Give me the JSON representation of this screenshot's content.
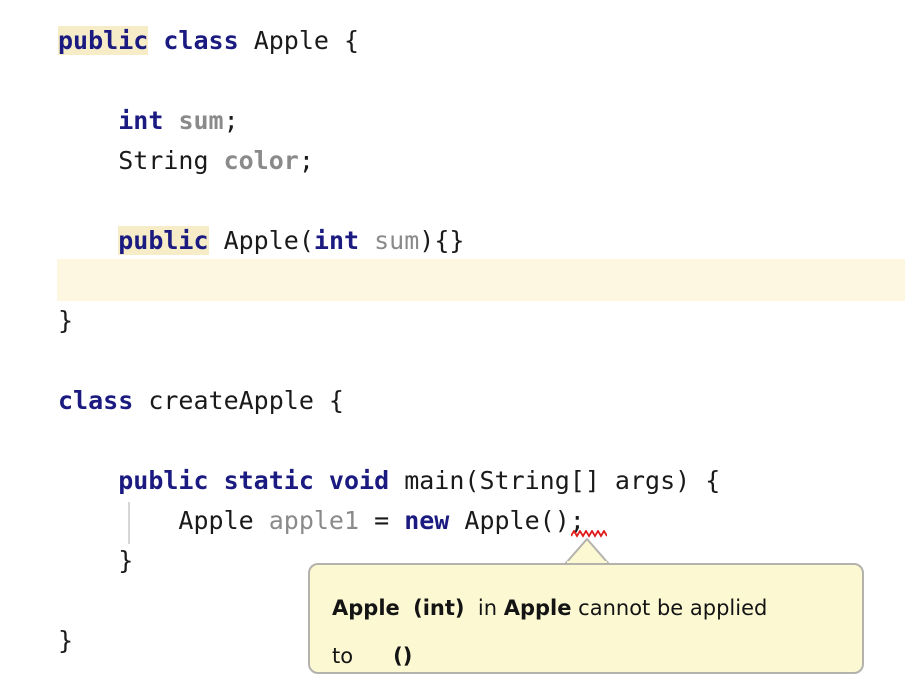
{
  "editor": {
    "background_color": "#ffffff",
    "keyword_color": "#1a1a80",
    "identifier_color": "#8a8a8a",
    "text_color": "#1a1a1a",
    "highlight_color": "#f6edc8",
    "caret_line_color": "#fdf6e0",
    "error_squiggle_color": "#e01b1b",
    "indent_guide_color": "#d7d7d7",
    "lines": [
      {
        "id": "line-1",
        "tokens": [
          {
            "text": "public",
            "style": "kw-hl"
          },
          {
            "text": " ",
            "style": "plain"
          },
          {
            "text": "class",
            "style": "kw"
          },
          {
            "text": " Apple {",
            "style": "plain"
          }
        ]
      },
      {
        "id": "line-3",
        "tokens": [
          {
            "text": "    ",
            "style": "plain"
          },
          {
            "text": "int",
            "style": "kw"
          },
          {
            "text": " ",
            "style": "plain"
          },
          {
            "text": "sum",
            "style": "ident-b"
          },
          {
            "text": ";",
            "style": "plain"
          }
        ]
      },
      {
        "id": "line-4",
        "tokens": [
          {
            "text": "    String ",
            "style": "plain"
          },
          {
            "text": "color",
            "style": "ident-b"
          },
          {
            "text": ";",
            "style": "plain"
          }
        ]
      },
      {
        "id": "line-6",
        "tokens": [
          {
            "text": "    ",
            "style": "plain"
          },
          {
            "text": "public",
            "style": "kw-hl"
          },
          {
            "text": " Apple(",
            "style": "plain"
          },
          {
            "text": "int",
            "style": "kw"
          },
          {
            "text": " ",
            "style": "plain"
          },
          {
            "text": "sum",
            "style": "ident"
          },
          {
            "text": "){}",
            "style": "plain"
          }
        ]
      },
      {
        "id": "line-8",
        "tokens": [
          {
            "text": "}",
            "style": "plain"
          }
        ]
      },
      {
        "id": "line-10",
        "tokens": [
          {
            "text": "class",
            "style": "kw"
          },
          {
            "text": " createApple {",
            "style": "plain"
          }
        ]
      },
      {
        "id": "line-12",
        "tokens": [
          {
            "text": "    ",
            "style": "plain"
          },
          {
            "text": "public static void",
            "style": "kw"
          },
          {
            "text": " main(String[] args) {",
            "style": "plain"
          }
        ]
      },
      {
        "id": "line-13",
        "tokens": [
          {
            "text": "        Apple ",
            "style": "plain"
          },
          {
            "text": "apple1",
            "style": "ident"
          },
          {
            "text": " = ",
            "style": "plain"
          },
          {
            "text": "new",
            "style": "kw"
          },
          {
            "text": " Apple();",
            "style": "plain"
          }
        ]
      },
      {
        "id": "line-14",
        "tokens": [
          {
            "text": "    }",
            "style": "plain"
          }
        ]
      },
      {
        "id": "line-16",
        "tokens": [
          {
            "text": "}",
            "style": "plain"
          }
        ]
      }
    ],
    "plain_text": {
      "line_1": "public class Apple {",
      "line_3": "    int sum;",
      "line_4": "    String color;",
      "line_6": "    public Apple(int sum){}",
      "line_8": "}",
      "line_10": "class createApple {",
      "line_12": "    public static void main(String[] args) {",
      "line_13": "        Apple apple1 = new Apple();",
      "line_14": "    }",
      "line_16": "}"
    }
  },
  "error_tooltip": {
    "line1": {
      "part_a": "Apple",
      "part_b": "(int)",
      "part_c": "in",
      "part_d": "Apple",
      "part_e": "cannot be applied"
    },
    "line2": {
      "part_a": "to",
      "part_b": "()"
    },
    "full_text": "Apple  (int)  in Apple cannot be applied to      ()",
    "background_color": "#fbf8d2",
    "border_color": "#b4b2ac"
  }
}
